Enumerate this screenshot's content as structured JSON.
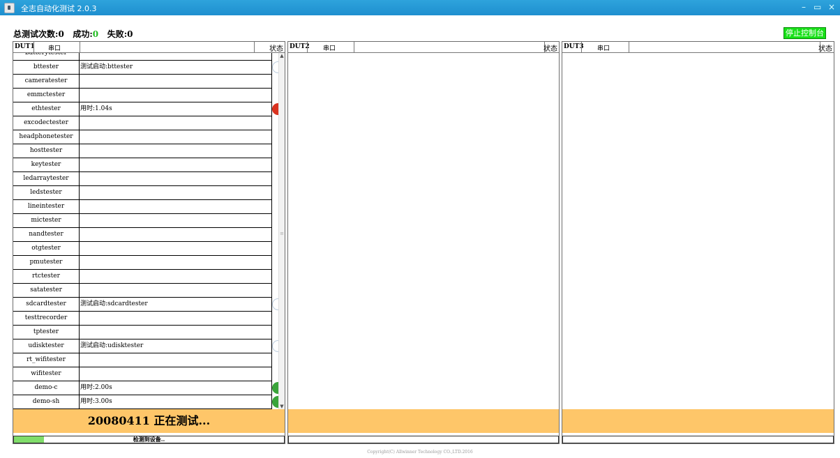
{
  "window": {
    "title": "全志自动化测试 2.0.3",
    "controls": {
      "minimize": "–",
      "maximize": "▭",
      "close": "×"
    }
  },
  "summary": {
    "total_label": "总测试次数:",
    "total_value": "0",
    "success_label": "成功:",
    "success_value": "0",
    "fail_label": "失败:",
    "fail_value": "0"
  },
  "stop_button": "停止控制台",
  "panels": [
    {
      "dut": "DUT1",
      "port_label": "串口",
      "status_label": "状态",
      "rows": [
        {
          "name": "batterytester",
          "msg": "",
          "state": "none"
        },
        {
          "name": "bttester",
          "msg": "测试启动:bttester",
          "state": "running"
        },
        {
          "name": "cameratester",
          "msg": "",
          "state": "none"
        },
        {
          "name": "emmctester",
          "msg": "",
          "state": "none"
        },
        {
          "name": "ethtester",
          "msg": "用时:1.04s",
          "state": "fail"
        },
        {
          "name": "excodectester",
          "msg": "",
          "state": "none"
        },
        {
          "name": "headphonetester",
          "msg": "",
          "state": "none"
        },
        {
          "name": "hosttester",
          "msg": "",
          "state": "none"
        },
        {
          "name": "keytester",
          "msg": "",
          "state": "none"
        },
        {
          "name": "ledarraytester",
          "msg": "",
          "state": "none"
        },
        {
          "name": "ledstester",
          "msg": "",
          "state": "none"
        },
        {
          "name": "lineintester",
          "msg": "",
          "state": "none"
        },
        {
          "name": "mictester",
          "msg": "",
          "state": "none"
        },
        {
          "name": "nandtester",
          "msg": "",
          "state": "none"
        },
        {
          "name": "otgtester",
          "msg": "",
          "state": "none"
        },
        {
          "name": "pmutester",
          "msg": "",
          "state": "none"
        },
        {
          "name": "rtctester",
          "msg": "",
          "state": "none"
        },
        {
          "name": "satatester",
          "msg": "",
          "state": "none"
        },
        {
          "name": "sdcardtester",
          "msg": "测试启动:sdcardtester",
          "state": "running"
        },
        {
          "name": "testtrecorder",
          "msg": "",
          "state": "none"
        },
        {
          "name": "tptester",
          "msg": "",
          "state": "none"
        },
        {
          "name": "udisktester",
          "msg": "测试启动:udisktester",
          "state": "running"
        },
        {
          "name": "rt_wifitester",
          "msg": "",
          "state": "none"
        },
        {
          "name": "wifitester",
          "msg": "",
          "state": "none"
        },
        {
          "name": "demo-c",
          "msg": "用时:2.00s",
          "state": "pass"
        },
        {
          "name": "demo-sh",
          "msg": "用时:3.00s",
          "state": "pass"
        }
      ],
      "status_text": "20080411 正在测试...",
      "progress_text": "检测到设备..",
      "progress_fraction": 0.11
    },
    {
      "dut": "DUT2",
      "port_label": "串口",
      "status_label": "状态",
      "rows": [],
      "status_text": "",
      "progress_text": "",
      "progress_fraction": 0
    },
    {
      "dut": "DUT3",
      "port_label": "串口",
      "status_label": "状态",
      "rows": [],
      "status_text": "",
      "progress_text": "",
      "progress_fraction": 0
    }
  ],
  "footer": "Copyright(C) Allwinner Technology CO.,LTD.2016",
  "colors": {
    "titlebar": "#1e8fcf",
    "status_bar": "#fec669",
    "stop_button": "#17e017",
    "progress": "#80dd6a",
    "fail": "#d9321f",
    "pass": "#3aa43a",
    "success_text": "#22bb22"
  }
}
